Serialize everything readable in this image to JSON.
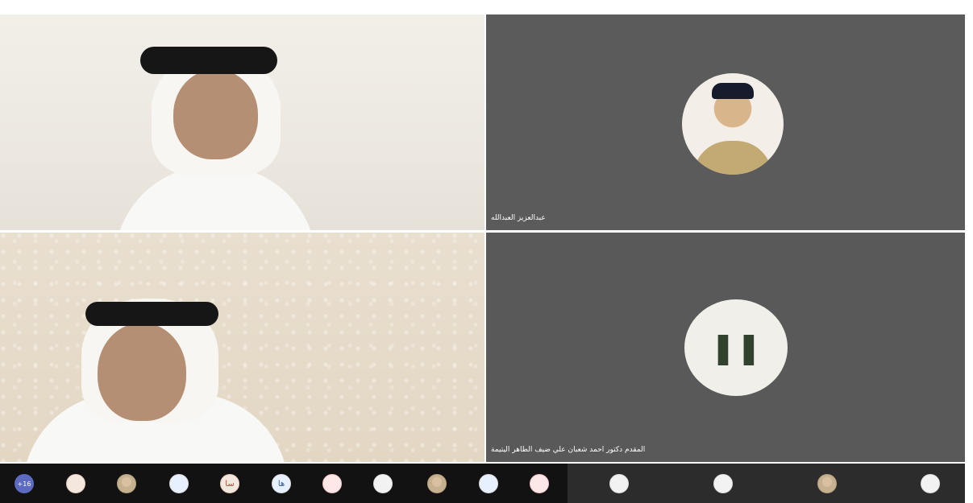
{
  "meeting": {
    "participants": [
      {
        "name": "",
        "tile": "video"
      },
      {
        "name": "عبدالعزيز العبدالله",
        "tile": "avatar-photo"
      },
      {
        "name": "",
        "tile": "video"
      },
      {
        "name": "المقدم دكتور احمد شعبان علي ضيف الطاهر اليتيمة",
        "tile": "avatar-paused"
      }
    ],
    "bottom_bar": {
      "overflow_count": "+16",
      "items": [
        {
          "label": "",
          "style": "orange"
        },
        {
          "label": "",
          "style": "photo"
        },
        {
          "label": "",
          "style": "blue"
        },
        {
          "label": "سا",
          "style": "orange"
        },
        {
          "label": "ها",
          "style": "blue"
        },
        {
          "label": "",
          "style": "red"
        },
        {
          "label": "",
          "style": "light"
        },
        {
          "label": "",
          "style": "photo"
        },
        {
          "label": "",
          "style": "blue"
        },
        {
          "label": "",
          "style": "red"
        },
        {
          "label": "",
          "style": "light"
        },
        {
          "label": "",
          "style": "light"
        },
        {
          "label": "",
          "style": "photo"
        },
        {
          "label": "",
          "style": "light"
        }
      ]
    }
  },
  "colors": {
    "tile_dark": "#5b5b5b",
    "bar_bg": "#121212",
    "bar_panel": "#2c2c2c",
    "overflow_badge": "#5c6bc0"
  }
}
